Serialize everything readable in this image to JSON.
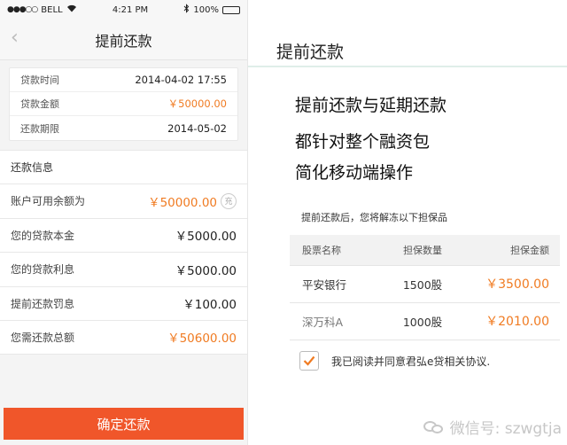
{
  "phone": {
    "status": {
      "carrier": "BELL",
      "time": "4:21 PM",
      "battery": "100%",
      "signal_dots": "●●●○○"
    },
    "nav": {
      "title": "提前还款",
      "back_icon": "chevron-left-icon"
    },
    "loan": [
      {
        "label": "贷款时间",
        "value": "2014-04-02  17:55"
      },
      {
        "label": "贷款金额",
        "value": "￥50000.00"
      },
      {
        "label": "还款期限",
        "value": "2014-05-02"
      }
    ],
    "section_title": "还款信息",
    "repay": [
      {
        "label": "账户可用余额为",
        "value": "￥50000.00",
        "badge": "充"
      },
      {
        "label": "您的贷款本金",
        "value": "￥5000.00"
      },
      {
        "label": "您的贷款利息",
        "value": "￥5000.00"
      },
      {
        "label": "提前还款罚息",
        "value": "￥100.00"
      },
      {
        "label": "您需还款总额",
        "value": "￥50600.00"
      }
    ],
    "confirm_label": "确定还款",
    "colors": {
      "accent": "#f07b22",
      "button": "#f0562a"
    }
  },
  "panel": {
    "title": "提前还款",
    "headlines": [
      "提前还款与延期还款",
      "都针对整个融资包",
      "简化移动端操作"
    ],
    "notice": "提前还款后，您将解冻以下担保品",
    "table": {
      "headers": [
        "股票名称",
        "担保数量",
        "担保金额"
      ],
      "rows": [
        [
          "平安银行",
          "1500股",
          "￥3500.00"
        ],
        [
          "深万科A",
          "1000股",
          "￥2010.00"
        ]
      ]
    },
    "agree_text": "我已阅读并同意君弘e贷相关协议.",
    "agree_checked": true,
    "watermark": "微信号: szwgtja"
  }
}
